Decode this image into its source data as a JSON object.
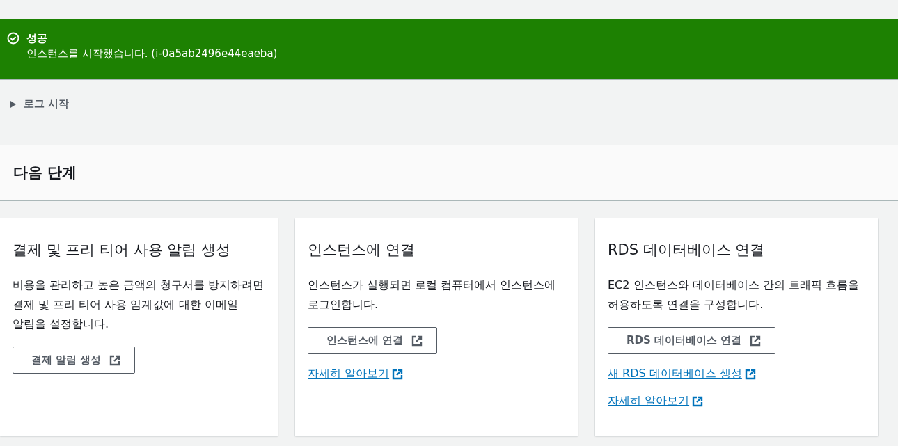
{
  "flash": {
    "title": "성공",
    "message": "인스턴스를 시작했습니다. (",
    "link": "i-0a5ab2496e44eaeba",
    "message_end": ")"
  },
  "launch_log": {
    "label": "로그 시작",
    "expanded": false
  },
  "next_steps": {
    "title": "다음 단계",
    "cards": [
      {
        "title": "결제 및 프리 티어 사용 알림 생성",
        "description": "비용을 관리하고 높은 금액의 청구서를 방지하려면 결제 및 프리 티어 사용 임계값에 대한 이메일 알림을 설정합니다.",
        "button": "결제 알림 생성"
      },
      {
        "title": "인스턴스에 연결",
        "description": "인스턴스가 실행되면 로컬 컴퓨터에서 인스턴스에 로그인합니다.",
        "button": "인스턴스에 연결",
        "links": [
          "자세히 알아보기"
        ]
      },
      {
        "title": "RDS 데이터베이스 연결",
        "description": "EC2 인스턴스와 데이터베이스 간의 트래픽 흐름을 허용하도록 연결을 구성합니다.",
        "button": "RDS 데이터베이스 연결",
        "links": [
          "새 RDS 데이터베이스 생성",
          "자세히 알아보기"
        ]
      }
    ]
  }
}
